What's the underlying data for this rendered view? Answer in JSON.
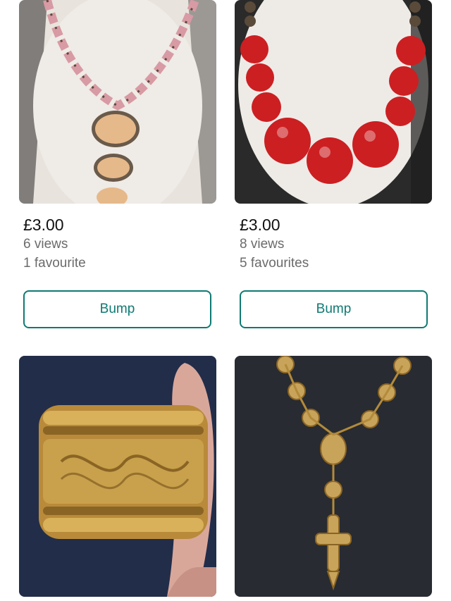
{
  "items": [
    {
      "price": "£3.00",
      "views": "6 views",
      "favourites": "1 favourite",
      "action_label": "Bump",
      "image": "pink-bead-pendant-necklace"
    },
    {
      "price": "£3.00",
      "views": "8 views",
      "favourites": "5 favourites",
      "action_label": "Bump",
      "image": "red-bead-necklace"
    },
    {
      "image": "gold-engraved-cuff-bracelet"
    },
    {
      "image": "gold-rosary-cross-necklace"
    }
  ],
  "colors": {
    "accent": "#0e7a73",
    "price_text": "#111111",
    "meta_text": "#6b6b6b"
  }
}
